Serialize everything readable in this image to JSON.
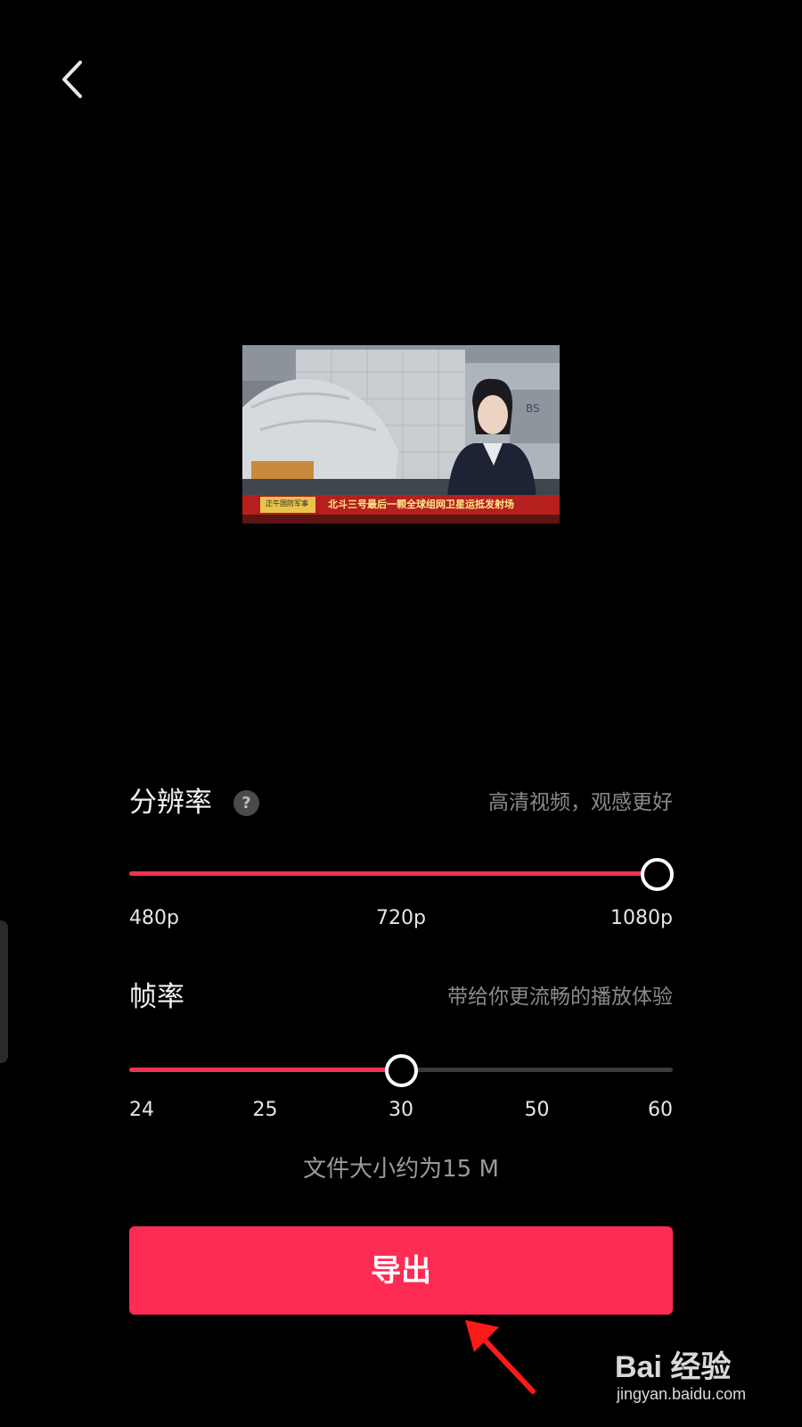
{
  "nav": {
    "back_icon": "chevron-left-icon"
  },
  "preview": {
    "ticker_tag": "正午国防军事",
    "ticker_text": "北斗三号最后一颗全球组网卫星运抵发射场",
    "building_label": "BS"
  },
  "resolution": {
    "title": "分辨率",
    "help_glyph": "?",
    "hint": "高清视频，观感更好",
    "options": [
      "480p",
      "720p",
      "1080p"
    ],
    "selected": "1080p",
    "selected_fraction": 1.0
  },
  "framerate": {
    "title": "帧率",
    "hint": "带给你更流畅的播放体验",
    "options": [
      "24",
      "25",
      "30",
      "50",
      "60"
    ],
    "selected": "30",
    "selected_fraction": 0.5
  },
  "file_size_text": "文件大小约为15 M",
  "export_label": "导出",
  "colors": {
    "accent": "#fe2c55",
    "track_fill": "#f0344f",
    "background": "#000000"
  },
  "watermark": {
    "brand": "Bai 经验",
    "url": "jingyan.baidu.com"
  }
}
